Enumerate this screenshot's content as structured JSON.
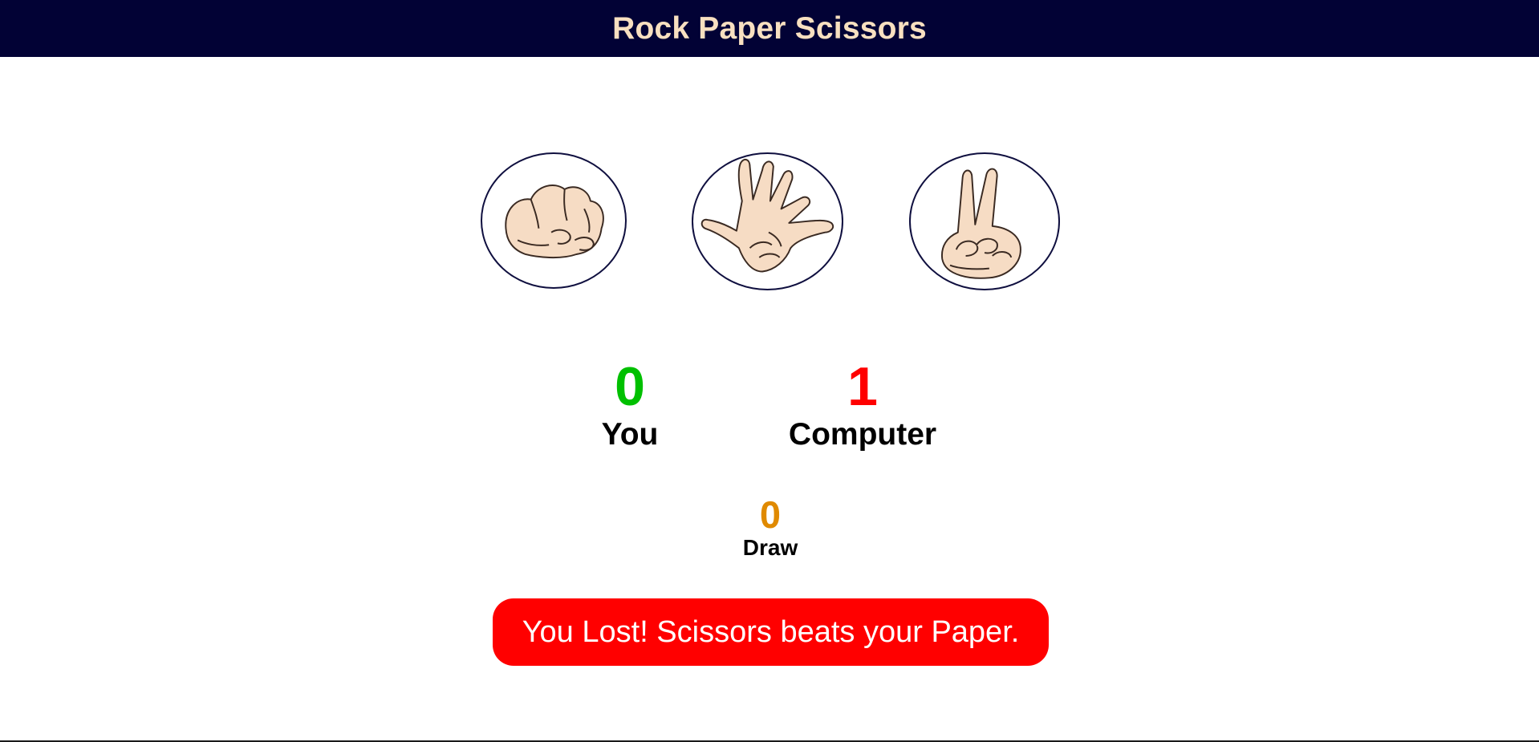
{
  "header": {
    "title": "Rock Paper Scissors"
  },
  "choices": [
    {
      "id": "rock",
      "icon": "fist-hand-icon"
    },
    {
      "id": "paper",
      "icon": "open-hand-icon"
    },
    {
      "id": "scissors",
      "icon": "peace-hand-icon"
    }
  ],
  "scores": {
    "user": {
      "value": "0",
      "label": "You",
      "color": "#00c000"
    },
    "computer": {
      "value": "1",
      "label": "Computer",
      "color": "#ff0000"
    },
    "draw": {
      "value": "0",
      "label": "Draw",
      "color": "#e08a00"
    }
  },
  "result": {
    "message": "You Lost! Scissors beats your Paper.",
    "color": "#ff0000"
  },
  "colors": {
    "header_bg": "#020235",
    "header_text": "#f8e0c0",
    "circle_border": "#0f0f3f",
    "skin": "#f6dcc4"
  }
}
